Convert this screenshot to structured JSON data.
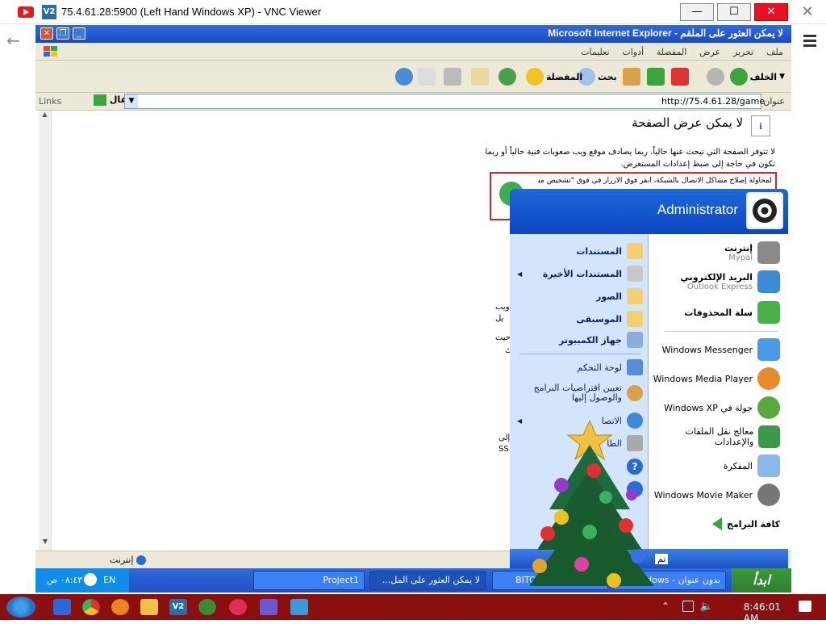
{
  "vnc": {
    "title": "75.4.61.28:5900 (Left Hand Windows XP) - VNC Viewer",
    "app_icon": "V2"
  },
  "ie": {
    "title": "لا يمكن العثور على الملقم - Microsoft Internet Explorer",
    "menu": [
      "ملف",
      "تحرير",
      "عرض",
      "المفضلة",
      "أدوات",
      "تعليمات"
    ],
    "toolbar": {
      "back": "الخلف",
      "search": "بحث",
      "favorites": "المفضلة"
    },
    "address": {
      "label": "عنوان",
      "url": "http://75.4.61.28/game",
      "go": "انتقال",
      "links": "Links"
    },
    "page": {
      "heading": "لا يمكن عرض الصفحة",
      "p1": "لا تتوفر الصفحة التي تبحث عنها حالياً. ربما يصادف موقع ويب صعوبات فنية حالياً أو ربما تكون في حاجة إلى ضبط إعدادات المستعرض.",
      "hint": "لمحاولة إصلاح مشاكل الاتصال بالشبكة، انقر فوق الأزرار في فوق \"تشخيص مشاكل",
      "frag1": "ويب",
      "frag2": "يل",
      "frag3": "حيث",
      "frag4": "ك",
      "frag5": "إلى",
      "frag6": "SS."
    },
    "status": {
      "done": "تم",
      "zone": "إنترنت"
    }
  },
  "start_menu": {
    "user": "Administrator",
    "pinned": [
      {
        "label": "إنترنت",
        "sub": "Mypal",
        "icon": "raccoon-icon"
      },
      {
        "label": "البريد الإلكتروني",
        "sub": "Outlook Express",
        "icon": "email-icon"
      },
      {
        "label": "سلة المحذوفات",
        "sub": "",
        "icon": "recycle-bin-icon"
      }
    ],
    "recent": [
      {
        "label": "Windows Messenger",
        "icon": "messenger-icon"
      },
      {
        "label": "Windows Media Player",
        "icon": "media-player-icon"
      },
      {
        "label": "جولة في Windows XP",
        "icon": "tour-icon"
      },
      {
        "label": "معالج نقل الملفات والإعدادات",
        "icon": "transfer-wizard-icon"
      },
      {
        "label": "المفكرة",
        "icon": "notepad-icon"
      },
      {
        "label": "Windows Movie Maker",
        "icon": "movie-maker-icon"
      }
    ],
    "all_programs": "كافة البرامج",
    "places": [
      {
        "label": "المستندات",
        "arrow": false
      },
      {
        "label": "المستندات الأخيرة",
        "arrow": true
      },
      {
        "label": "الصور",
        "arrow": false
      },
      {
        "label": "الموسيقى",
        "arrow": false
      },
      {
        "label": "جهاز الكمبيوتر",
        "arrow": false
      }
    ],
    "system": [
      {
        "label": "لوحة التحكم"
      },
      {
        "label": "تعيين افتراضيات البرامج والوصول إليها"
      },
      {
        "label": "الاتصا"
      },
      {
        "label": "الطا"
      }
    ],
    "foot_fragment": "تم"
  },
  "xp_taskbar": {
    "start": "ابدأ",
    "buttons": [
      {
        "label": "بدون عنوان - Windows..."
      },
      {
        "label": "BITCH ASS NIGGA 5"
      },
      {
        "label": "لا يمكن العثور على المل..."
      },
      {
        "label": "Project1"
      }
    ],
    "lang": "EN",
    "time": "٠٨:٤٣ ص"
  },
  "host": {
    "time": "8:46:01 AM"
  }
}
